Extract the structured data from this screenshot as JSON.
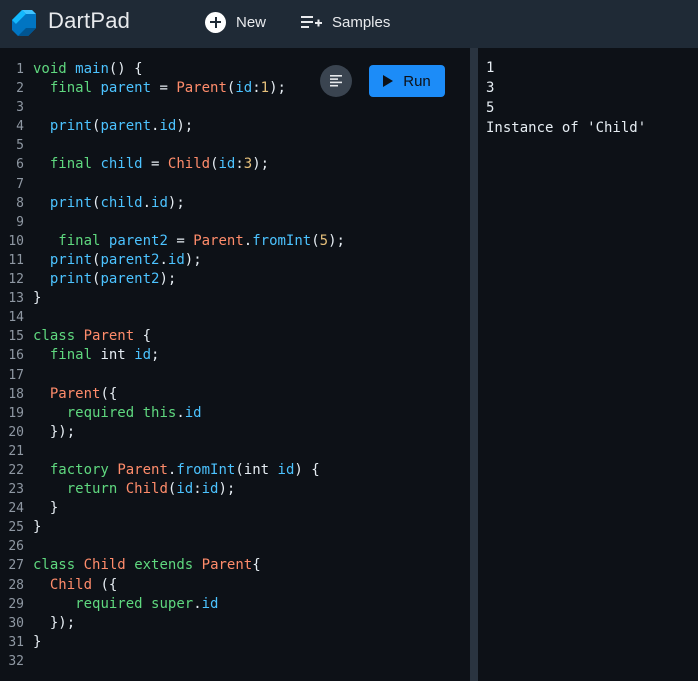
{
  "header": {
    "brand": "DartPad",
    "new_label": "New",
    "samples_label": "Samples"
  },
  "editor": {
    "run_label": "Run",
    "line_numbers": [
      "1",
      "2",
      "3",
      "4",
      "5",
      "6",
      "7",
      "8",
      "9",
      "10",
      "11",
      "12",
      "13",
      "14",
      "15",
      "16",
      "17",
      "18",
      "19",
      "20",
      "21",
      "22",
      "23",
      "24",
      "25",
      "26",
      "27",
      "28",
      "29",
      "30",
      "31",
      "32"
    ]
  },
  "code_lines": [
    [
      [
        "k",
        "void"
      ],
      [
        "p",
        " "
      ],
      [
        "f",
        "main"
      ],
      [
        "p",
        "() {"
      ]
    ],
    [
      [
        "p",
        "  "
      ],
      [
        "k",
        "final"
      ],
      [
        "p",
        " "
      ],
      [
        "f",
        "parent"
      ],
      [
        "p",
        " = "
      ],
      [
        "t",
        "Parent"
      ],
      [
        "p",
        "("
      ],
      [
        "f",
        "id"
      ],
      [
        "p",
        ":"
      ],
      [
        "num",
        "1"
      ],
      [
        "p",
        ");"
      ]
    ],
    [],
    [
      [
        "p",
        "  "
      ],
      [
        "f",
        "print"
      ],
      [
        "p",
        "("
      ],
      [
        "f",
        "parent"
      ],
      [
        "p",
        "."
      ],
      [
        "f",
        "id"
      ],
      [
        "p",
        ");"
      ]
    ],
    [],
    [
      [
        "p",
        "  "
      ],
      [
        "k",
        "final"
      ],
      [
        "p",
        " "
      ],
      [
        "f",
        "child"
      ],
      [
        "p",
        " = "
      ],
      [
        "t",
        "Child"
      ],
      [
        "p",
        "("
      ],
      [
        "f",
        "id"
      ],
      [
        "p",
        ":"
      ],
      [
        "num",
        "3"
      ],
      [
        "p",
        ");"
      ]
    ],
    [],
    [
      [
        "p",
        "  "
      ],
      [
        "f",
        "print"
      ],
      [
        "p",
        "("
      ],
      [
        "f",
        "child"
      ],
      [
        "p",
        "."
      ],
      [
        "f",
        "id"
      ],
      [
        "p",
        ");"
      ]
    ],
    [],
    [
      [
        "p",
        "   "
      ],
      [
        "k",
        "final"
      ],
      [
        "p",
        " "
      ],
      [
        "f",
        "parent2"
      ],
      [
        "p",
        " = "
      ],
      [
        "t",
        "Parent"
      ],
      [
        "p",
        "."
      ],
      [
        "f",
        "fromInt"
      ],
      [
        "p",
        "("
      ],
      [
        "num",
        "5"
      ],
      [
        "p",
        ");"
      ]
    ],
    [
      [
        "p",
        "  "
      ],
      [
        "f",
        "print"
      ],
      [
        "p",
        "("
      ],
      [
        "f",
        "parent2"
      ],
      [
        "p",
        "."
      ],
      [
        "f",
        "id"
      ],
      [
        "p",
        ");"
      ]
    ],
    [
      [
        "p",
        "  "
      ],
      [
        "f",
        "print"
      ],
      [
        "p",
        "("
      ],
      [
        "f",
        "parent2"
      ],
      [
        "p",
        ");"
      ]
    ],
    [
      [
        "p",
        "}"
      ]
    ],
    [],
    [
      [
        "k",
        "class"
      ],
      [
        "p",
        " "
      ],
      [
        "t",
        "Parent"
      ],
      [
        "p",
        " {"
      ]
    ],
    [
      [
        "p",
        "  "
      ],
      [
        "k",
        "final"
      ],
      [
        "p",
        " "
      ],
      [
        "p",
        "int"
      ],
      [
        "p",
        " "
      ],
      [
        "f",
        "id"
      ],
      [
        "p",
        ";"
      ]
    ],
    [],
    [
      [
        "p",
        "  "
      ],
      [
        "t",
        "Parent"
      ],
      [
        "p",
        "({"
      ]
    ],
    [
      [
        "p",
        "    "
      ],
      [
        "k",
        "required"
      ],
      [
        "p",
        " "
      ],
      [
        "k",
        "this"
      ],
      [
        "p",
        "."
      ],
      [
        "f",
        "id"
      ]
    ],
    [
      [
        "p",
        "  });"
      ]
    ],
    [],
    [
      [
        "p",
        "  "
      ],
      [
        "k",
        "factory"
      ],
      [
        "p",
        " "
      ],
      [
        "t",
        "Parent"
      ],
      [
        "p",
        "."
      ],
      [
        "f",
        "fromInt"
      ],
      [
        "p",
        "("
      ],
      [
        "p",
        "int"
      ],
      [
        "p",
        " "
      ],
      [
        "f",
        "id"
      ],
      [
        "p",
        ") {"
      ]
    ],
    [
      [
        "p",
        "    "
      ],
      [
        "k",
        "return"
      ],
      [
        "p",
        " "
      ],
      [
        "t",
        "Child"
      ],
      [
        "p",
        "("
      ],
      [
        "f",
        "id"
      ],
      [
        "p",
        ":"
      ],
      [
        "f",
        "id"
      ],
      [
        "p",
        ");"
      ]
    ],
    [
      [
        "p",
        "  }"
      ]
    ],
    [
      [
        "p",
        "}"
      ]
    ],
    [],
    [
      [
        "k",
        "class"
      ],
      [
        "p",
        " "
      ],
      [
        "t",
        "Child"
      ],
      [
        "p",
        " "
      ],
      [
        "k",
        "extends"
      ],
      [
        "p",
        " "
      ],
      [
        "t",
        "Parent"
      ],
      [
        "p",
        "{"
      ]
    ],
    [
      [
        "p",
        "  "
      ],
      [
        "t",
        "Child"
      ],
      [
        "p",
        " ({"
      ]
    ],
    [
      [
        "p",
        "     "
      ],
      [
        "k",
        "required"
      ],
      [
        "p",
        " "
      ],
      [
        "k",
        "super"
      ],
      [
        "p",
        "."
      ],
      [
        "f",
        "id"
      ]
    ],
    [
      [
        "p",
        "  });"
      ]
    ],
    [
      [
        "p",
        "}"
      ]
    ],
    []
  ],
  "console": {
    "lines": [
      "1",
      "3",
      "5",
      "Instance of 'Child'"
    ]
  }
}
